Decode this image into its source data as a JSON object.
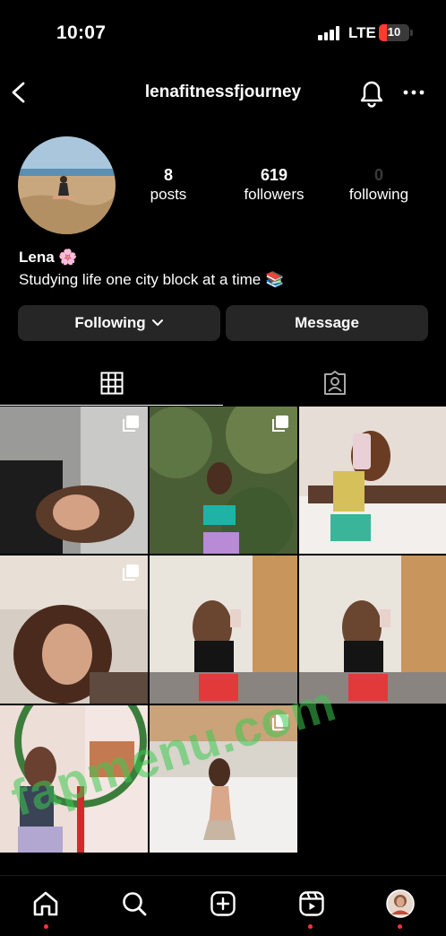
{
  "status_bar": {
    "time": "10:07",
    "network": "LTE",
    "battery": "10",
    "battery_color": "#ff3b30"
  },
  "header": {
    "username": "lenafitnessfjourney",
    "back_icon": "chevron-left-icon",
    "bell_icon": "bell-icon",
    "more_icon": "more-horizontal-icon"
  },
  "profile": {
    "stats": [
      {
        "value": "8",
        "label": "posts"
      },
      {
        "value": "619",
        "label": "followers"
      },
      {
        "value": "0",
        "label": "following"
      }
    ],
    "display_name": "Lena 🌸",
    "bio": "Studying life one city block at a time 📚"
  },
  "actions": {
    "following_label": "Following",
    "message_label": "Message"
  },
  "tabs": [
    {
      "icon": "grid-icon",
      "active": true
    },
    {
      "icon": "tagged-person-icon",
      "active": false
    }
  ],
  "posts": [
    {
      "multi": true
    },
    {
      "multi": true
    },
    {
      "multi": false
    },
    {
      "multi": true
    },
    {
      "multi": false
    },
    {
      "multi": false
    },
    {
      "multi": false
    },
    {
      "multi": true
    }
  ],
  "watermark": "fapmenu.com",
  "bottom_nav": [
    {
      "icon": "home-icon",
      "active": true
    },
    {
      "icon": "search-icon",
      "active": false
    },
    {
      "icon": "create-post-icon",
      "active": false
    },
    {
      "icon": "reels-icon",
      "active": false
    },
    {
      "icon": "profile-avatar-icon",
      "active": false
    }
  ],
  "accent_color": "#ff3040"
}
